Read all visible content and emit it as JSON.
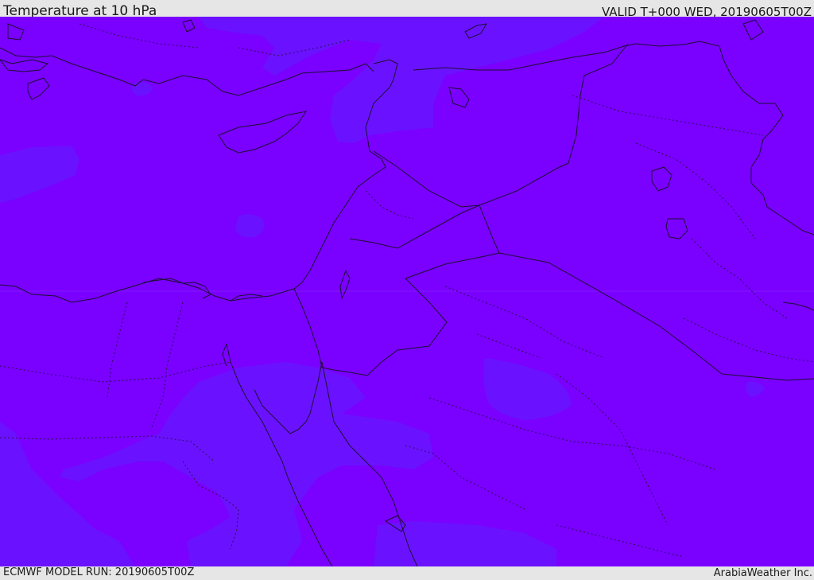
{
  "header": {
    "title": "Temperature at 10 hPa",
    "valid": "VALID T+000 WED, 20190605T00Z"
  },
  "footer": {
    "model_run": "ECMWF MODEL RUN: 20190605T00Z",
    "credit": "ArabiaWeather Inc."
  },
  "colors": {
    "field_base": "#7a00ff",
    "field_cooler": "#6a12ff",
    "border_line": "#1c1030",
    "frame_bg": "#e6e6e6"
  },
  "map": {
    "variable": "temperature",
    "level": "10 hPa",
    "region": "Eastern Mediterranean and Middle East"
  }
}
